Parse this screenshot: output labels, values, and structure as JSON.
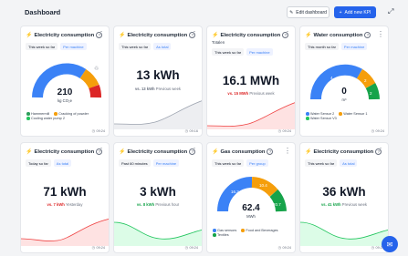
{
  "header": {
    "title": "Dashboard",
    "edit_label": "Edit dashboard",
    "add_label": "Add new KPI"
  },
  "cards": [
    {
      "title": "Electricity consumption",
      "chips": [
        "This week so far",
        "Per machine"
      ],
      "gauge_value": "210",
      "gauge_unit": "kg CO₂e",
      "gauge_label": "17k",
      "legend": [
        {
          "label": "Hammermill",
          "color": "#2e9e5b"
        },
        {
          "label": "Cracking of powder",
          "color": "#f59e0b"
        },
        {
          "label": "Cooling water pump 2",
          "color": "#22c55e"
        }
      ],
      "time": "09:24"
    },
    {
      "title": "Electricity consumption",
      "chips": [
        "This week so far",
        "As total"
      ],
      "value": "13 kWh",
      "cmp_value": "vs. 13 kWh",
      "cmp_text": "Previous week",
      "cmp_color": "#6b7280",
      "wave": "gray",
      "time": "09:16"
    },
    {
      "title": "Electricity consumption",
      "subtitle": "Totalen",
      "chips": [
        "This week so far",
        "Per machine"
      ],
      "value": "16.1 MWh",
      "cmp_value": "vs. 15 MWh",
      "cmp_text": "Previous week",
      "cmp_color": "#dc2626",
      "wave": "red",
      "time": "09:24"
    },
    {
      "title": "Water consumption",
      "chips": [
        "This month so far",
        "Per machine"
      ],
      "gauge_value": "0",
      "gauge_unit": "m³",
      "gauge_labels": [
        "4",
        "2",
        "2"
      ],
      "legend": [
        {
          "label": "Water Sensor 2",
          "color": "#3b82f6"
        },
        {
          "label": "Water Sensor 1",
          "color": "#f59e0b"
        },
        {
          "label": "Water Sensor V3",
          "color": "#22c55e"
        }
      ],
      "time": "09:24"
    },
    {
      "title": "Electricity consumption",
      "chips": [
        "Today so far",
        "As total"
      ],
      "value": "71 kWh",
      "cmp_value": "vs. 7 kWh",
      "cmp_text": "Yesterday",
      "cmp_color": "#dc2626",
      "wave": "red",
      "time": "09:24"
    },
    {
      "title": "Electricity consumption",
      "chips": [
        "Past 60 minutes",
        "Per machine"
      ],
      "value": "3 kWh",
      "cmp_value": "vs. 8 kWh",
      "cmp_text": "Previous hour",
      "cmp_color": "#16a34a",
      "wave": "green",
      "time": "09:24"
    },
    {
      "title": "Gas consumption",
      "chips": [
        "This week so far",
        "Per group"
      ],
      "gauge_value": "62.4",
      "gauge_unit": "MWh",
      "gauge_labels": [
        "16.3",
        "10.4",
        "20.7"
      ],
      "legend": [
        {
          "label": "Gas sensors",
          "color": "#3b82f6"
        },
        {
          "label": "Food and Beverages",
          "color": "#f59e0b"
        },
        {
          "label": "Textiles",
          "color": "#16a34a"
        }
      ],
      "time": "09:24"
    },
    {
      "title": "Electricity consumption",
      "chips": [
        "This week so far",
        "As total"
      ],
      "value": "36 kWh",
      "cmp_value": "vs. 41 kWh",
      "cmp_text": "Previous week",
      "cmp_color": "#16a34a",
      "wave": "green",
      "time": "09:24"
    }
  ],
  "colors": {
    "accent": "#2563eb",
    "red": "#dc2626",
    "green": "#16a34a",
    "orange": "#f59e0b",
    "blue": "#3b82f6"
  }
}
